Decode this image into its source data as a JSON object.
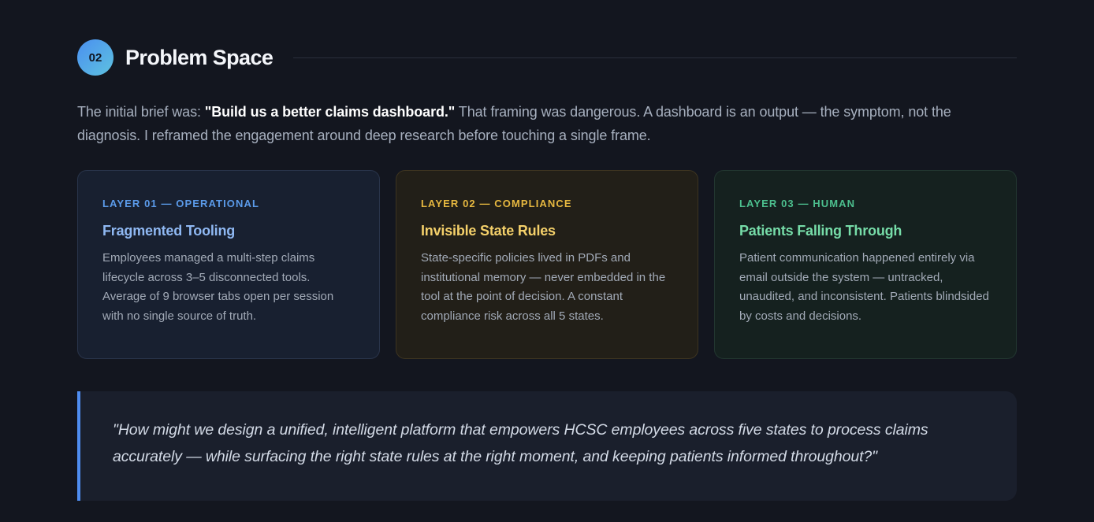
{
  "section": {
    "number": "02",
    "title": "Problem Space"
  },
  "intro": {
    "lead": "The initial brief was: ",
    "emphasis": "\"Build us a better claims dashboard.\"",
    "rest": " That framing was dangerous. A dashboard is an output — the symptom, not the diagnosis. I reframed the engagement around deep research before touching a single frame."
  },
  "cards": [
    {
      "layer": "LAYER 01 — OPERATIONAL",
      "title": "Fragmented Tooling",
      "body": "Employees managed a multi-step claims lifecycle across 3–5 disconnected tools. Average of 9 browser tabs open per session with no single source of truth."
    },
    {
      "layer": "LAYER 02 — COMPLIANCE",
      "title": "Invisible State Rules",
      "body": "State-specific policies lived in PDFs and institutional memory — never embedded in the tool at the point of decision. A constant compliance risk across all 5 states."
    },
    {
      "layer": "LAYER 03 — HUMAN",
      "title": "Patients Falling Through",
      "body": "Patient communication happened entirely via email outside the system — untracked, unaudited, and inconsistent. Patients blindsided by costs and decisions."
    }
  ],
  "quote": "\"How might we design a unified, intelligent platform that empowers HCSC employees across five states to process claims accurately — while surfacing the right state rules at the right moment, and keeping patients informed throughout?\"",
  "colors": {
    "background": "#13161f",
    "accent_blue": "#4f8df0",
    "accent_amber": "#e7b840",
    "accent_green": "#4cbf8e"
  }
}
